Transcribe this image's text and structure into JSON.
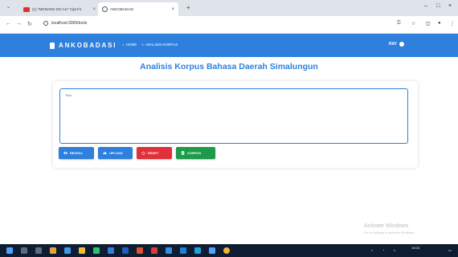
{
  "browser": {
    "tabs": [
      {
        "title": "(1) \"MONANG DO AU\" Cipt.Fir",
        "icon": "youtube-icon"
      },
      {
        "title": "ANKOBADASI",
        "icon": "globe-icon"
      }
    ],
    "url": "localhost:3000/tools"
  },
  "navbar": {
    "brand": "ANKOBADASI",
    "links": [
      {
        "label": "HOME",
        "icon": "home-icon"
      },
      {
        "label": "ANALISIS KORPUS",
        "icon": "share-icon"
      }
    ],
    "user": "RAY",
    "color": "#2f7fdc"
  },
  "main": {
    "title": "Analisis Korpus Bahasa Daerah Simalungun",
    "textarea_placeholder": "Teks",
    "buttons": [
      {
        "label": "REVEAL",
        "icon": "eye-icon",
        "color": "#2f7fdc"
      },
      {
        "label": "UPLOAD",
        "icon": "cloud-upload-icon",
        "color": "#2f7fdc"
      },
      {
        "label": "RESET",
        "icon": "power-icon",
        "color": "#e0303a"
      },
      {
        "label": "CORPUS",
        "icon": "document-icon",
        "color": "#1e9a4b"
      }
    ]
  },
  "watermark": {
    "line1": "Activate Windows",
    "line2": "Go to Settings to activate Windows."
  },
  "taskbar": {
    "time": "19.03"
  }
}
